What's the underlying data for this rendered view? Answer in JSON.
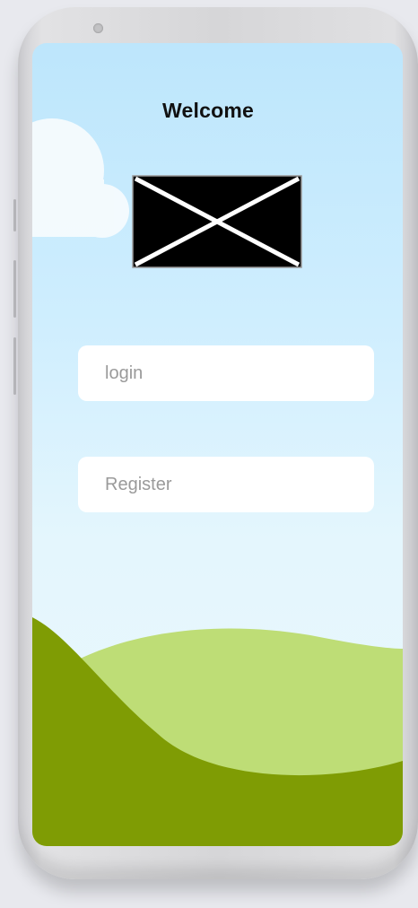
{
  "screen": {
    "title": "Welcome"
  },
  "form": {
    "login_placeholder": "login",
    "register_placeholder": "Register"
  },
  "icons": {
    "image": "broken-image-icon",
    "camera": "camera-icon"
  },
  "colors": {
    "sky_top": "#bde6fc",
    "sky_bottom": "#eaf8fc",
    "hill_light": "#bedd76",
    "hill_dark": "#7f9c04",
    "field_bg": "#ffffff"
  }
}
